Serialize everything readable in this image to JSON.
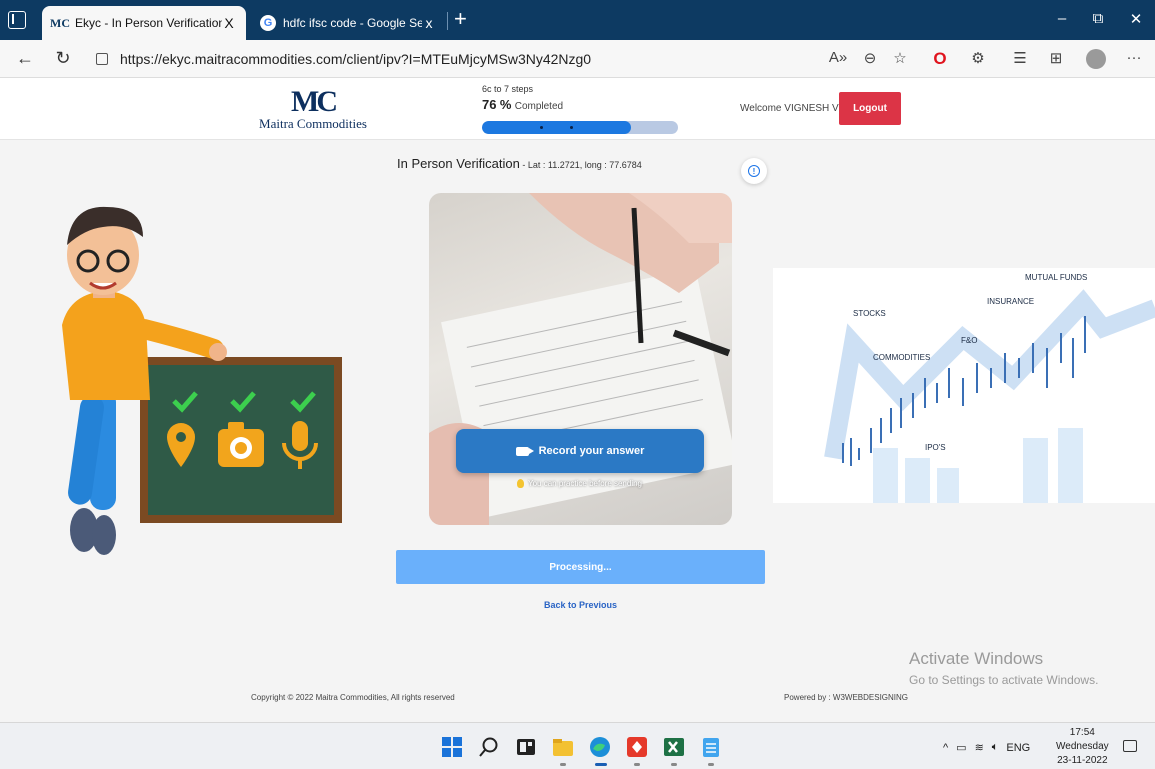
{
  "browser": {
    "tabs": [
      {
        "label": "Ekyc - In Person Verification",
        "favicon": "MC",
        "active": true
      },
      {
        "label": "hdfc ifsc code - Google Search",
        "favicon": "G",
        "active": false
      }
    ],
    "close_glyph": "X",
    "url": "https://ekyc.maitracommodities.com/client/ipv?I=MTEuMjcyMSw3Ny42Nzg0"
  },
  "header": {
    "logo_mark": "MC",
    "logo_name": "Maitra Commodities",
    "steps_label": "6c to 7 steps",
    "progress_percent": "76",
    "percent_sign": "%",
    "completed_label": "Completed",
    "progress_fraction": 0.76,
    "welcome": "Welcome VIGNESH V",
    "logout": "Logout"
  },
  "main": {
    "title": "In Person Verification",
    "coords": " - Lat : 11.2721, long : 77.6784",
    "record_label": "Record your answer",
    "practice_note": "You can practice before sending",
    "processing": "Processing...",
    "back_link": "Back to Previous"
  },
  "finance_labels": {
    "mutual_funds": "MUTUAL FUNDS",
    "insurance": "INSURANCE",
    "stocks": "STOCKS",
    "fo": "F&O",
    "commodities": "COMMODITIES",
    "ipos": "IPO'S"
  },
  "watermark": {
    "line1": "Activate Windows",
    "line2": "Go to Settings to activate Windows."
  },
  "footer": {
    "copyright": "Copyright © 2022 Maitra Commodities, All rights reserved",
    "powered": "Powered by : W3WEBDESIGNING"
  },
  "taskbar": {
    "lang": "ENG",
    "time": "17:54",
    "day": "Wednesday",
    "date": "23-11-2022"
  },
  "colors": {
    "brand": "#0d2f5e",
    "logout": "#dc3446",
    "record": "#2b79c5",
    "processing": "#6ab0fb",
    "progress": "#1c78e0"
  }
}
